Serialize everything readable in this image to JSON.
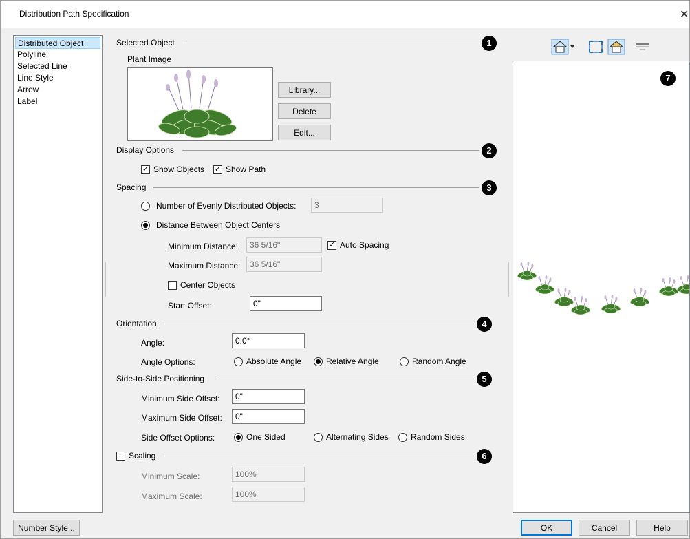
{
  "window": {
    "title": "Distribution Path Specification",
    "close_glyph": "✕"
  },
  "sidebar": {
    "items": [
      {
        "label": "Distributed Object",
        "selected": true
      },
      {
        "label": "Polyline"
      },
      {
        "label": "Selected Line"
      },
      {
        "label": "Line Style"
      },
      {
        "label": "Arrow"
      },
      {
        "label": "Label"
      }
    ]
  },
  "selected_object": {
    "header": "Selected Object",
    "marker": "1",
    "plant_image_label": "Plant Image",
    "library_button": "Library...",
    "delete_button": "Delete",
    "edit_button": "Edit..."
  },
  "display_options": {
    "header": "Display Options",
    "marker": "2",
    "show_objects": {
      "label": "Show Objects",
      "checked": true
    },
    "show_path": {
      "label": "Show Path",
      "checked": true
    }
  },
  "spacing": {
    "header": "Spacing",
    "marker": "3",
    "evenly_label": "Number of Evenly Distributed Objects:",
    "evenly_value": "3",
    "distance_label": "Distance Between Object Centers",
    "min_label": "Minimum Distance:",
    "min_value": "36 5/16\"",
    "auto_spacing_label": "Auto Spacing",
    "max_label": "Maximum Distance:",
    "max_value": "36 5/16\"",
    "center_objects_label": "Center Objects",
    "start_offset_label": "Start Offset:",
    "start_offset_value": "0\""
  },
  "orientation": {
    "header": "Orientation",
    "marker": "4",
    "angle_label": "Angle:",
    "angle_value": "0.0°",
    "angle_options_label": "Angle Options:",
    "absolute": "Absolute Angle",
    "relative": "Relative Angle",
    "random": "Random Angle",
    "selected": "relative"
  },
  "side_positioning": {
    "header": "Side-to-Side Positioning",
    "marker": "5",
    "min_label": "Minimum Side Offset:",
    "min_value": "0\"",
    "max_label": "Maximum Side Offset:",
    "max_value": "0\"",
    "options_label": "Side Offset Options:",
    "one_sided": "One Sided",
    "alternating": "Alternating Sides",
    "random": "Random Sides",
    "selected": "one_sided"
  },
  "scaling": {
    "header": "Scaling",
    "marker": "6",
    "checked": false,
    "min_label": "Minimum Scale:",
    "min_value": "100%",
    "max_label": "Maximum Scale:",
    "max_value": "100%"
  },
  "preview": {
    "marker": "7"
  },
  "footer": {
    "number_style_button": "Number Style...",
    "ok_button": "OK",
    "cancel_button": "Cancel",
    "help_button": "Help"
  },
  "icons": [
    "view-mode-icon",
    "fill-window-icon",
    "camera-view-icon",
    "drag-handle-icon",
    "check-mark-icon"
  ],
  "colors": {
    "selection_bg": "#cce8ff",
    "accent": "#0078d7",
    "plant_leaf": "#3f7d2c",
    "plant_flower": "#c9b3d6"
  }
}
